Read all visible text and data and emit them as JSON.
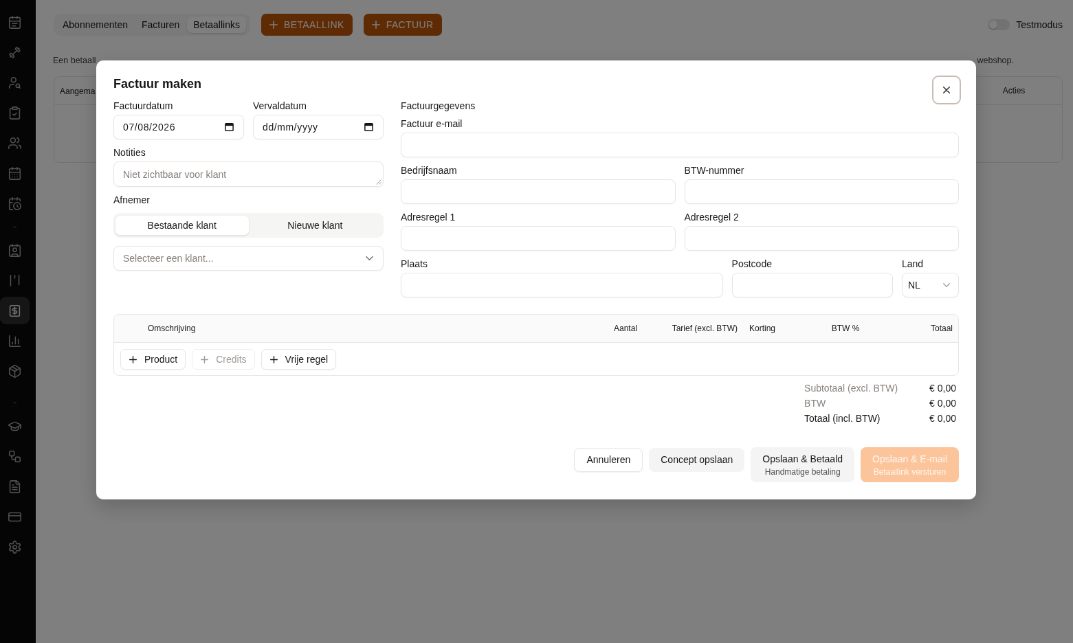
{
  "sidebar": {
    "groups": [
      {
        "items": [
          {
            "selected": false
          },
          {
            "selected": false
          },
          {
            "selected": false
          },
          {
            "selected": false
          },
          {
            "selected": false
          },
          {
            "selected": false
          },
          {
            "selected": false
          }
        ]
      },
      {
        "items": [
          {
            "selected": false
          },
          {
            "selected": false
          },
          {
            "selected": true
          },
          {
            "selected": false
          },
          {
            "selected": false
          }
        ]
      },
      {
        "items": [
          {
            "selected": false
          },
          {
            "selected": false
          },
          {
            "selected": false
          },
          {
            "selected": false
          },
          {
            "selected": false
          }
        ]
      }
    ]
  },
  "header": {
    "tabs": [
      {
        "label": "Abonnementen",
        "selected": false
      },
      {
        "label": "Facturen",
        "selected": false
      },
      {
        "label": "Betaallinks",
        "selected": true
      }
    ],
    "actions": [
      "BETAALLINK",
      "FACTUUR"
    ],
    "test_mode": {
      "label": "Testmodus",
      "on": false
    }
  },
  "page": {
    "description": {
      "visible_start": "Een betaall",
      "visible_end": "webshop."
    },
    "table": {
      "columns": [
        "Aangema",
        "Acties"
      ]
    }
  },
  "modal": {
    "title": "Factuur maken",
    "invoice_date": {
      "label": "Factuurdatum",
      "value": "07/08/2026"
    },
    "due_date": {
      "label": "Vervaldatum",
      "placeholder": "dd/mm/yyyy"
    },
    "notes": {
      "label": "Notities",
      "placeholder": "Niet zichtbaar voor klant"
    },
    "customer": {
      "label": "Afnemer",
      "options": [
        {
          "label": "Bestaande klant",
          "selected": true
        },
        {
          "label": "Nieuwe klant",
          "selected": false
        }
      ],
      "select": {
        "placeholder": "Selecteer een klant..."
      }
    },
    "billing": {
      "heading": "Factuurgegevens",
      "rows": [
        {
          "fields": [
            {
              "label": "Factuur e-mail",
              "kind": "text"
            }
          ]
        },
        {
          "fields": [
            {
              "label": "Bedrijfsnaam",
              "kind": "text"
            },
            {
              "label": "BTW-nummer",
              "kind": "text"
            }
          ]
        },
        {
          "fields": [
            {
              "label": "Adresregel 1",
              "kind": "text"
            },
            {
              "label": "Adresregel 2",
              "kind": "text"
            }
          ]
        },
        {
          "fields": [
            {
              "label": "Plaats",
              "kind": "text"
            },
            {
              "label": "Postcode",
              "kind": "text"
            },
            {
              "label": "Land",
              "kind": "select",
              "value": "NL"
            }
          ]
        }
      ]
    },
    "line_items": {
      "columns": [
        "Omschrijving",
        "Aantal",
        "Tarief (excl. BTW)",
        "Korting",
        "BTW %",
        "Totaal"
      ],
      "add_buttons": [
        {
          "label": "Product",
          "disabled": false
        },
        {
          "label": "Credits",
          "disabled": true
        },
        {
          "label": "Vrije regel",
          "disabled": false
        }
      ]
    },
    "totals": [
      {
        "label": "Subtotaal (excl. BTW)",
        "value": "€ 0,00",
        "kind": "subtotal"
      },
      {
        "label": "BTW",
        "value": "€ 0,00",
        "kind": "subtotal"
      },
      {
        "label": "Totaal (incl. BTW)",
        "value": "€ 0,00",
        "kind": "total"
      }
    ],
    "buttons": [
      {
        "label": "Annuleren",
        "kind": "outline",
        "disabled": false
      },
      {
        "label": "Concept opslaan",
        "kind": "secondary",
        "disabled": false
      },
      {
        "label": "Opslaan & Betaald",
        "sublabel": "Handmatige betaling",
        "kind": "secondary",
        "disabled": false
      },
      {
        "label": "Opslaan & E-mail",
        "sublabel": "Betaallink versturen",
        "kind": "primary",
        "disabled": true
      }
    ]
  }
}
